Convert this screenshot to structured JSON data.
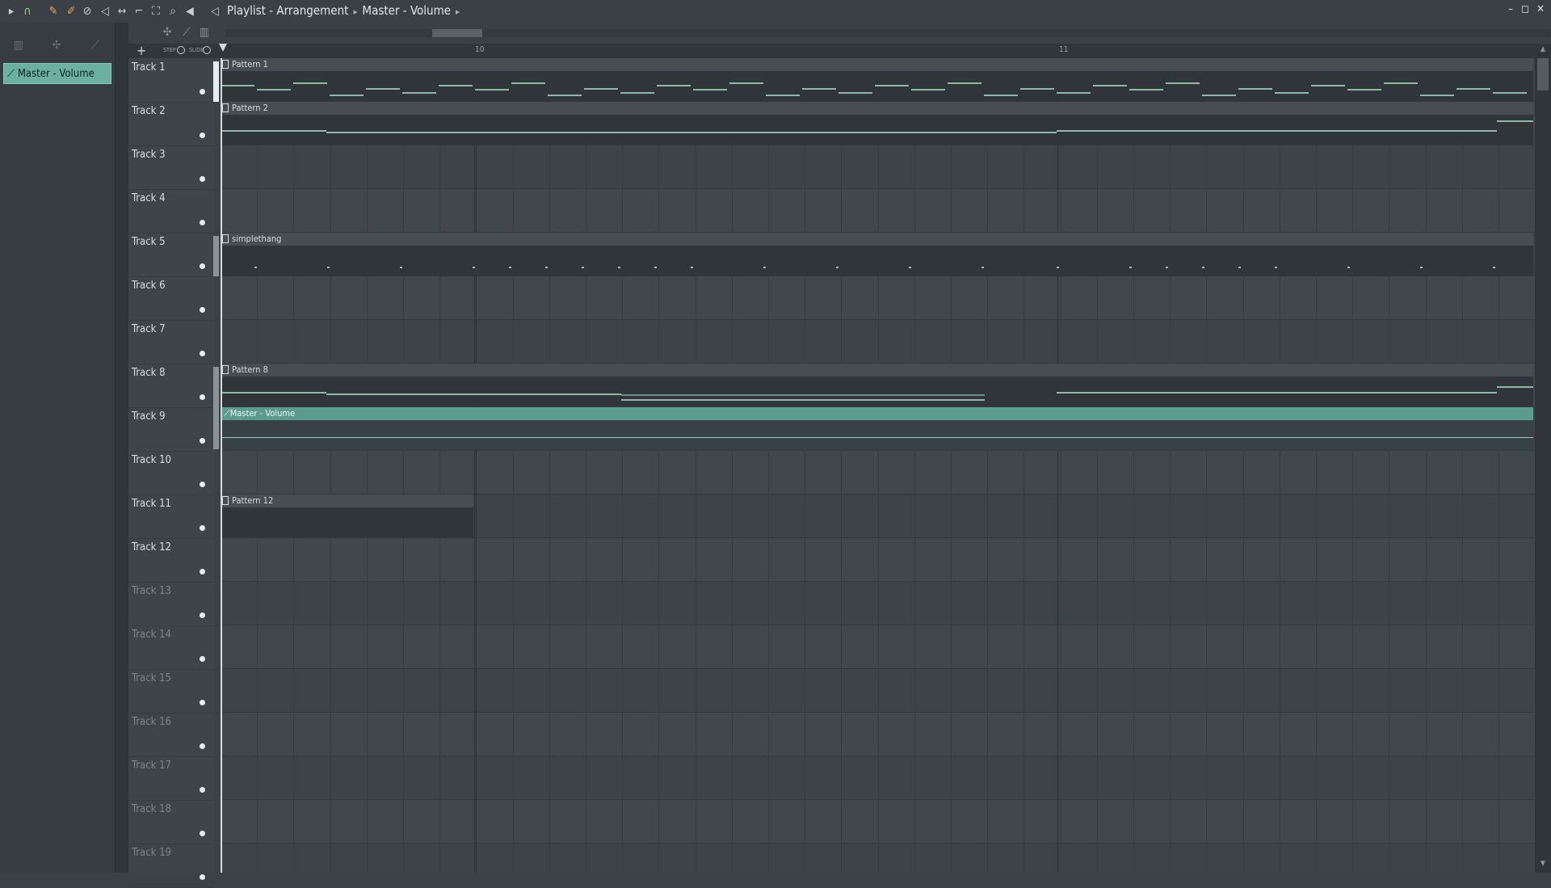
{
  "window": {
    "title_parts": [
      "Playlist - Arrangement",
      "Master - Volume"
    ],
    "minimize_symbol": "–",
    "maximize_symbol": "◻",
    "close_symbol": "✕"
  },
  "toolbar": {
    "icons": [
      "play-arrow-icon",
      "magnet-icon",
      "pencil-icon",
      "brush-icon",
      "delete-icon",
      "mute-icon",
      "slip-icon",
      "slice-icon",
      "select-icon",
      "zoom-icon",
      "playback-icon",
      "speaker-icon"
    ]
  },
  "browser": {
    "selected_clip": "Master - Volume"
  },
  "ruler": {
    "add_symbol": "+",
    "step_label": "STEP",
    "slide_label": "SLIDE",
    "bar_labels": [
      "10",
      "11"
    ]
  },
  "tracks": [
    {
      "name": "Track 1"
    },
    {
      "name": "Track 2"
    },
    {
      "name": "Track 3"
    },
    {
      "name": "Track 4"
    },
    {
      "name": "Track 5"
    },
    {
      "name": "Track 6"
    },
    {
      "name": "Track 7"
    },
    {
      "name": "Track 8"
    },
    {
      "name": "Track 9"
    },
    {
      "name": "Track 10"
    },
    {
      "name": "Track 11"
    },
    {
      "name": "Track 12"
    },
    {
      "name": "Track 13"
    },
    {
      "name": "Track 14"
    },
    {
      "name": "Track 15"
    },
    {
      "name": "Track 16"
    },
    {
      "name": "Track 17"
    },
    {
      "name": "Track 18"
    },
    {
      "name": "Track 19"
    }
  ],
  "clips": {
    "pattern1": "Pattern 1",
    "pattern2": "Pattern 2",
    "simplethang": "simplethang",
    "pattern8": "Pattern 8",
    "automation": "Master - Volume",
    "pattern12": "Pattern 12"
  },
  "colors": {
    "automation_clip": "#5b9c8e",
    "browser_selection": "#6bb0a0",
    "note": "#8fb9a6"
  }
}
